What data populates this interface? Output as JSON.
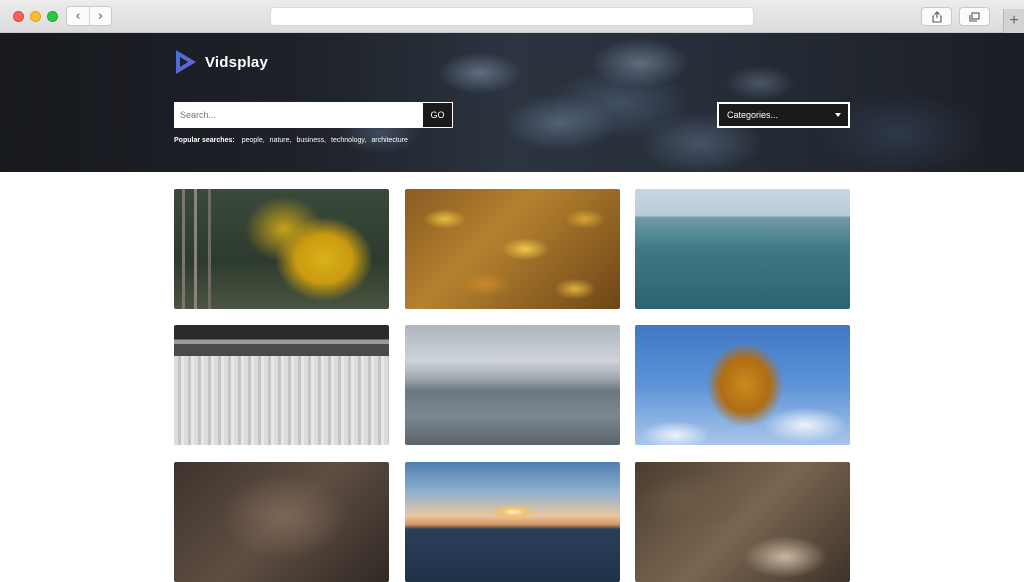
{
  "browser": {
    "back_icon": "chevron-left-icon",
    "forward_icon": "chevron-right-icon",
    "share_icon": "share-icon",
    "tabs_icon": "tabs-icon",
    "new_tab_icon": "plus-icon",
    "url": ""
  },
  "header": {
    "logo_text": "Vidsplay",
    "search": {
      "placeholder": "Search...",
      "value": ""
    },
    "go_label": "GO",
    "popular_label": "Popular searches:",
    "popular_tags": [
      "people,",
      "nature,",
      "business,",
      "technology,",
      "architecture"
    ],
    "categories_label": "Categories..."
  },
  "thumbnails": [
    {
      "name": "video-thumb-autumn-forest"
    },
    {
      "name": "video-thumb-fallen-leaves"
    },
    {
      "name": "video-thumb-open-sea"
    },
    {
      "name": "video-thumb-factory-conveyor"
    },
    {
      "name": "video-thumb-calm-lake"
    },
    {
      "name": "video-thumb-autumn-tree-sky"
    },
    {
      "name": "video-thumb-night-sky"
    },
    {
      "name": "video-thumb-sunset-water"
    },
    {
      "name": "video-thumb-rocks"
    }
  ],
  "colors": {
    "go_button": "#1a1a1a",
    "logo_accent_blue": "#3b73d8",
    "logo_accent_purple": "#7a5bd6"
  }
}
